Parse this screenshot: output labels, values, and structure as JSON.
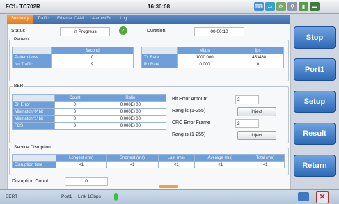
{
  "app": {
    "title": "FC1- TC702R",
    "time": "16:30:08"
  },
  "tabs": [
    "Summary",
    "Traffic",
    "Ethernet OAM",
    "Alarms/Err",
    "Log"
  ],
  "status": {
    "label": "Status",
    "value": "In Progress",
    "duration_label": "Duration",
    "duration": "00:00:10"
  },
  "pattern": {
    "title": "Pattern",
    "left_header": "Second",
    "left_rows": [
      {
        "label": "Pattern Loss",
        "value": "0"
      },
      {
        "label": "No Traffic",
        "value": "9"
      }
    ],
    "right_headers": [
      "Mbps",
      "fps"
    ],
    "right_rows": [
      {
        "label": "Tx Rate",
        "mbps": "1000.000",
        "fps": "1453488"
      },
      {
        "label": "Rx Rate",
        "mbps": "0.000",
        "fps": "0"
      }
    ]
  },
  "ber": {
    "title": "BER",
    "headers": [
      "Count",
      "Ratio"
    ],
    "rows": [
      {
        "label": "Bit Error",
        "count": "0",
        "ratio": "0.000E+00"
      },
      {
        "label": "Mismatch '0' bit",
        "count": "0",
        "ratio": "0.000E+00"
      },
      {
        "label": "Mismatch '1' bit",
        "count": "0",
        "ratio": "0.000E+00"
      },
      {
        "label": "FCS",
        "count": "0",
        "ratio": "0.000E+00"
      }
    ],
    "bit_error_amount_label": "Bit Error Amount",
    "bit_error_amount": "2",
    "range1": "Rang is (1-255)",
    "crc_label": "CRC Error Frame",
    "crc_value": "2",
    "range2": "Rang is (1-255)",
    "inject": "Inject"
  },
  "disruption": {
    "title": "Service Disruption",
    "headers": [
      "Longest (ms)",
      "Shortest (ms)",
      "Last (ms)",
      "Average (ms)",
      "Total (ms)"
    ],
    "row_label": "Disruption time",
    "values": [
      "<1",
      "<1",
      "<1",
      "<1",
      "<1"
    ],
    "count_label": "Disruption Count",
    "count": "0"
  },
  "buttons": {
    "stop": "Stop",
    "port": "Port1",
    "setup": "Setup",
    "result": "Result",
    "return": "Return"
  },
  "statusbar": {
    "mode": "BERT",
    "port": "Port1",
    "link": "Link 1Gbps"
  }
}
